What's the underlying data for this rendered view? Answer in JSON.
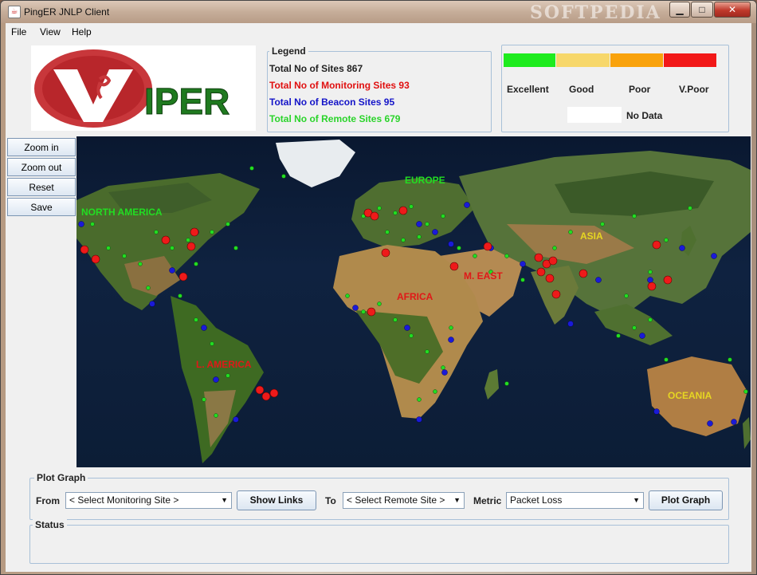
{
  "window": {
    "title": "PingER JNLP Client",
    "watermark": "SOFTPEDIA",
    "controls": {
      "minimize": "▁",
      "maximize": "□",
      "close": "✕"
    }
  },
  "menu": [
    "File",
    "View",
    "Help"
  ],
  "logo": {
    "text": "VIPER",
    "color_ring": "#c8373b",
    "color_text": "#1f7a1f"
  },
  "legend": {
    "title": "Legend",
    "total_sites": "Total No of Sites 867",
    "monitoring_sites": "Total No of Monitoring Sites 93",
    "beacon_sites": "Total No of Beacon Sites 95",
    "remote_sites": "Total No of Remote Sites 679",
    "colors": {
      "total": "#222222",
      "monitoring": "#e01010",
      "beacon": "#1414c8",
      "remote": "#2ad42a"
    }
  },
  "quality_scale": {
    "levels": [
      {
        "label": "Excellent",
        "color": "#1eeb1e"
      },
      {
        "label": "Good",
        "color": "#f7d76a"
      },
      {
        "label": "Poor",
        "color": "#f9a20c"
      },
      {
        "label": "V.Poor",
        "color": "#f21818"
      }
    ],
    "no_data_label": "No Data"
  },
  "map_tools": [
    "Zoom in",
    "Zoom out",
    "Reset",
    "Save"
  ],
  "map_regions": [
    {
      "name": "NORTH AMERICA",
      "color": "#22dd22"
    },
    {
      "name": "EUROPE",
      "color": "#22dd22"
    },
    {
      "name": "ASIA",
      "color": "#e6d622"
    },
    {
      "name": "M. EAST",
      "color": "#e01818"
    },
    {
      "name": "AFRICA",
      "color": "#e01818"
    },
    {
      "name": "L. AMERICA",
      "color": "#e01818"
    },
    {
      "name": "OCEANIA",
      "color": "#e6d622"
    }
  ],
  "plot_graph": {
    "title": "Plot Graph",
    "from_label": "From",
    "from_value": "< Select Monitoring Site >",
    "show_links": "Show Links",
    "to_label": "To",
    "to_value": "< Select Remote Site >",
    "metric_label": "Metric",
    "metric_value": "Packet Loss",
    "plot_button": "Plot Graph"
  },
  "status": {
    "title": "Status"
  }
}
